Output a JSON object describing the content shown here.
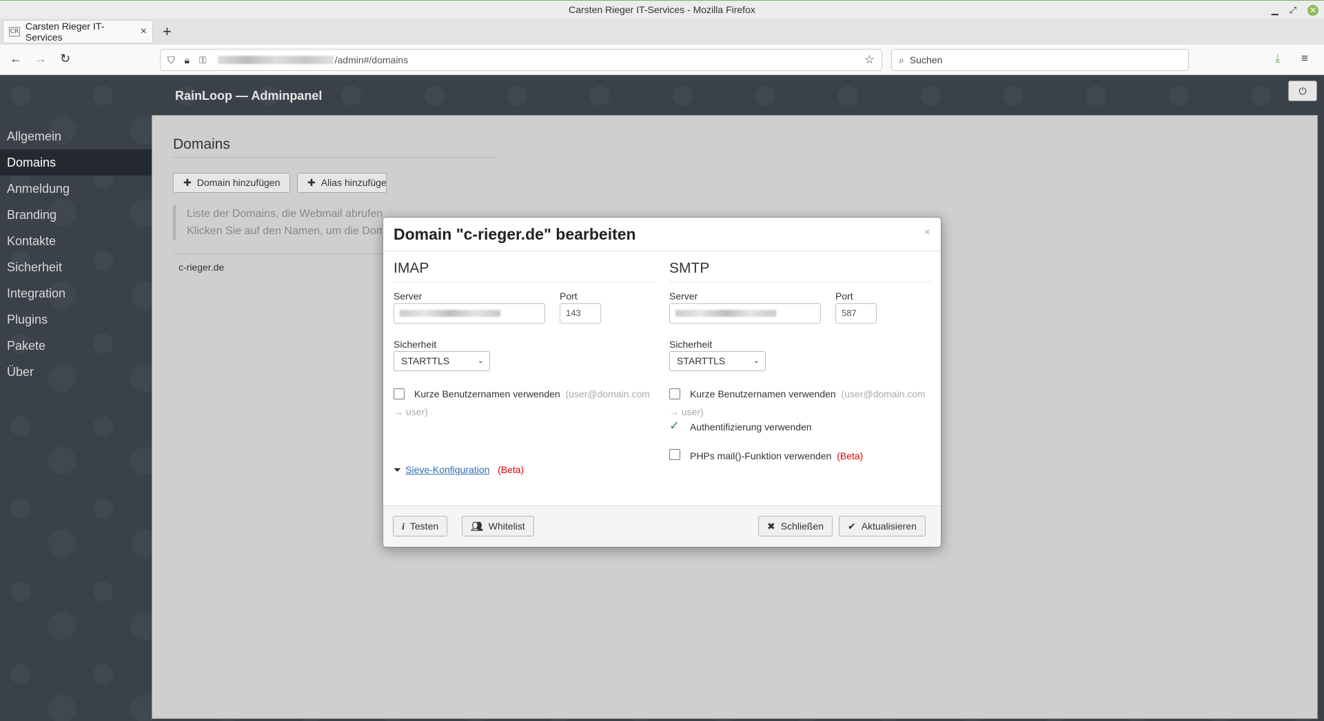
{
  "window": {
    "title": "Carsten Rieger IT-Services - Mozilla Firefox"
  },
  "browser": {
    "tab_title": "Carsten Rieger IT-Services",
    "tab_favicon": "CR",
    "url_suffix": "/admin#/domains",
    "search_placeholder": "Suchen"
  },
  "app": {
    "header": "RainLoop — Adminpanel"
  },
  "sidebar": {
    "items": [
      {
        "label": "Allgemein"
      },
      {
        "label": "Domains"
      },
      {
        "label": "Anmeldung"
      },
      {
        "label": "Branding"
      },
      {
        "label": "Kontakte"
      },
      {
        "label": "Sicherheit"
      },
      {
        "label": "Integration"
      },
      {
        "label": "Plugins"
      },
      {
        "label": "Pakete"
      },
      {
        "label": "Über"
      }
    ],
    "active": "Domains"
  },
  "content": {
    "title": "Domains",
    "add_domain": "Domain hinzufügen",
    "add_alias": "Alias hinzufügen",
    "info_line1": "Liste der Domains, die Webmail abrufen",
    "info_line2": "Klicken Sie auf den Namen, um die Dom",
    "domains": [
      "c-rieger.de"
    ]
  },
  "modal": {
    "title": "Domain \"c-rieger.de\" bearbeiten",
    "imap": {
      "heading": "IMAP",
      "server_label": "Server",
      "port_label": "Port",
      "port": "143",
      "security_label": "Sicherheit",
      "security": "STARTTLS",
      "short_login": "Kurze Benutzernamen verwenden",
      "short_hint": "(user@domain.com",
      "short_hint2": "→ user)",
      "sieve": "Sieve-Konfiguration",
      "beta": "(Beta)"
    },
    "smtp": {
      "heading": "SMTP",
      "server_label": "Server",
      "port_label": "Port",
      "port": "587",
      "security_label": "Sicherheit",
      "security": "STARTTLS",
      "short_login": "Kurze Benutzernamen verwenden",
      "short_hint": "(user@domain.com",
      "short_hint2": "→ user)",
      "auth": "Authentifizierung verwenden",
      "php_mail": "PHPs mail()-Funktion verwenden",
      "beta": "(Beta)"
    },
    "buttons": {
      "test": "Testen",
      "whitelist": "Whitelist",
      "close": "Schließen",
      "update": "Aktualisieren"
    }
  }
}
